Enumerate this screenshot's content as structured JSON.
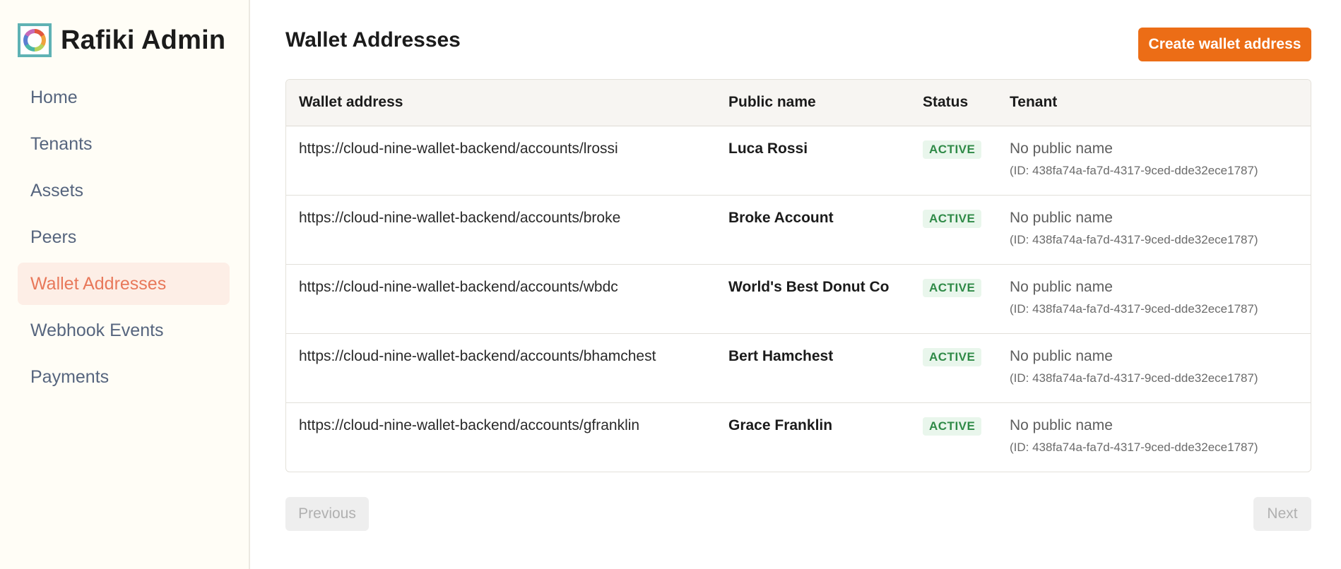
{
  "app": {
    "title": "Rafiki Admin"
  },
  "sidebar": {
    "items": [
      {
        "label": "Home",
        "active": false
      },
      {
        "label": "Tenants",
        "active": false
      },
      {
        "label": "Assets",
        "active": false
      },
      {
        "label": "Peers",
        "active": false
      },
      {
        "label": "Wallet Addresses",
        "active": true
      },
      {
        "label": "Webhook Events",
        "active": false
      },
      {
        "label": "Payments",
        "active": false
      }
    ]
  },
  "page": {
    "title": "Wallet Addresses",
    "create_button": "Create wallet address"
  },
  "table": {
    "columns": [
      "Wallet address",
      "Public name",
      "Status",
      "Tenant"
    ],
    "rows": [
      {
        "address": "https://cloud-nine-wallet-backend/accounts/lrossi",
        "public_name": "Luca Rossi",
        "status": "ACTIVE",
        "tenant_name": "No public name",
        "tenant_id": "(ID: 438fa74a-fa7d-4317-9ced-dde32ece1787)"
      },
      {
        "address": "https://cloud-nine-wallet-backend/accounts/broke",
        "public_name": "Broke Account",
        "status": "ACTIVE",
        "tenant_name": "No public name",
        "tenant_id": "(ID: 438fa74a-fa7d-4317-9ced-dde32ece1787)"
      },
      {
        "address": "https://cloud-nine-wallet-backend/accounts/wbdc",
        "public_name": "World's Best Donut Co",
        "status": "ACTIVE",
        "tenant_name": "No public name",
        "tenant_id": "(ID: 438fa74a-fa7d-4317-9ced-dde32ece1787)"
      },
      {
        "address": "https://cloud-nine-wallet-backend/accounts/bhamchest",
        "public_name": "Bert Hamchest",
        "status": "ACTIVE",
        "tenant_name": "No public name",
        "tenant_id": "(ID: 438fa74a-fa7d-4317-9ced-dde32ece1787)"
      },
      {
        "address": "https://cloud-nine-wallet-backend/accounts/gfranklin",
        "public_name": "Grace Franklin",
        "status": "ACTIVE",
        "tenant_name": "No public name",
        "tenant_id": "(ID: 438fa74a-fa7d-4317-9ced-dde32ece1787)"
      }
    ]
  },
  "pagination": {
    "previous": "Previous",
    "next": "Next"
  },
  "colors": {
    "accent": "#ec6d16",
    "active_nav": "#e8785a",
    "status_active": "#2f8a47"
  }
}
